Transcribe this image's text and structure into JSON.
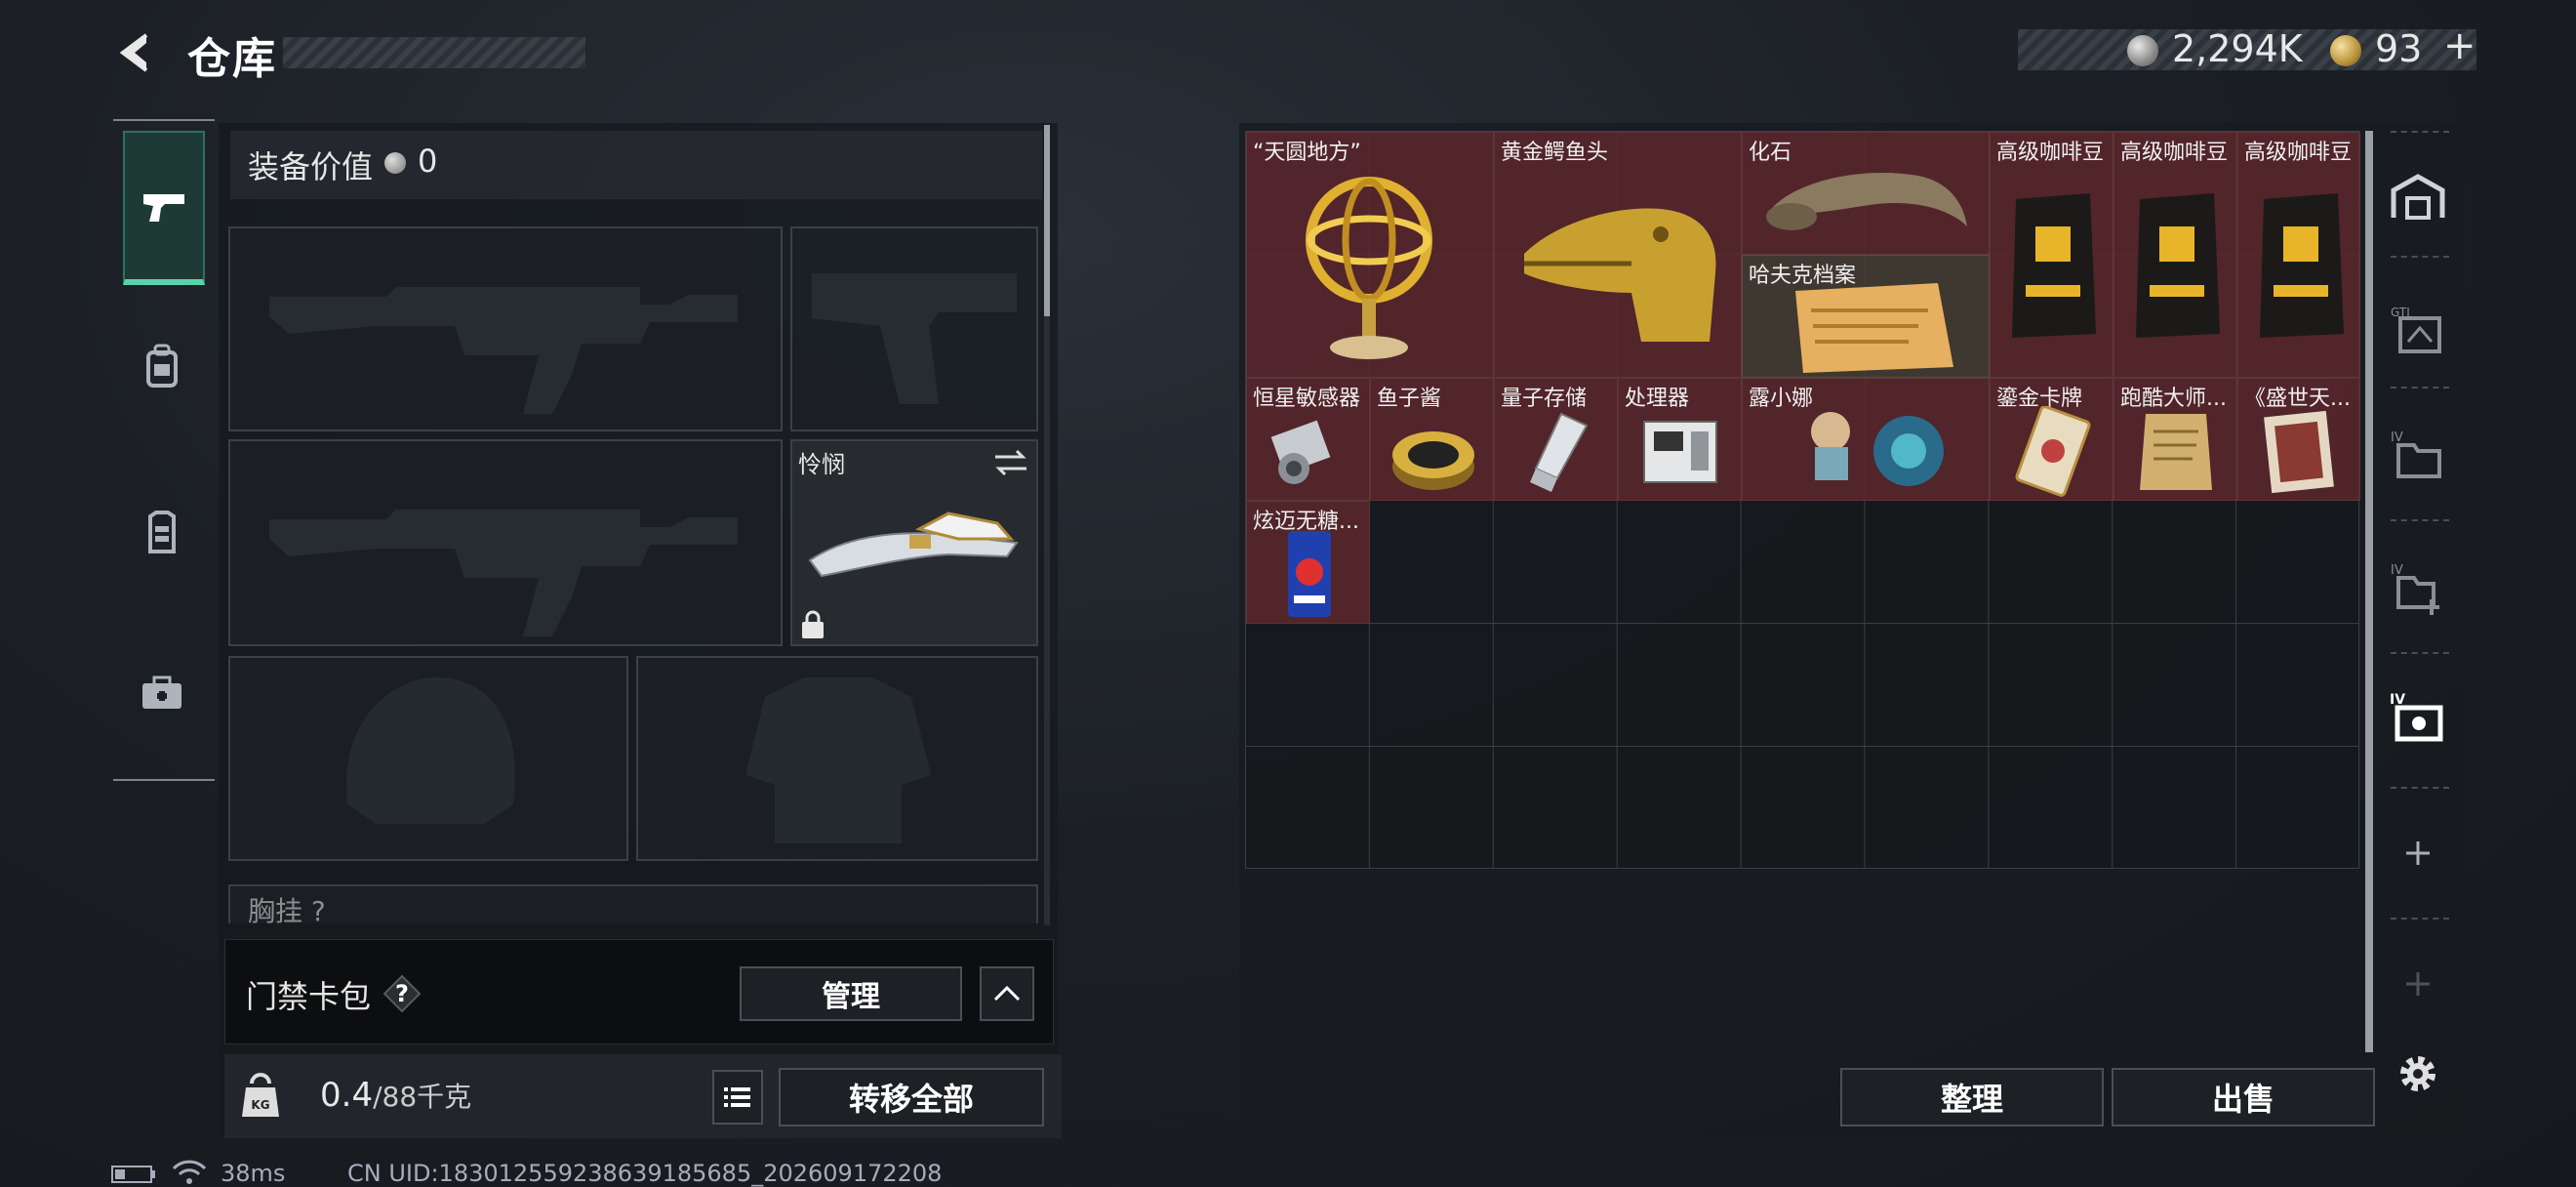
{
  "header": {
    "title": "仓库"
  },
  "currency": {
    "silver": "2,294K",
    "gold": "93",
    "gold_add": "+"
  },
  "equipment": {
    "value_label": "装备价值",
    "value": "0",
    "melee_name": "怜悯",
    "chest_label": "胸挂",
    "chest_help": "?"
  },
  "keycard": {
    "label": "门禁卡包",
    "help": "?",
    "manage_label": "管理"
  },
  "weight": {
    "value": "0.4",
    "unit": "/88千克",
    "kg_label": "KG"
  },
  "buttons": {
    "transfer_all": "转移全部",
    "sort": "整理",
    "sell": "出售"
  },
  "status": {
    "ping": "38ms",
    "uid": "CN UID:1830125592386391856​85_202609172208"
  },
  "warehouse": {
    "items": [
      {
        "name": "“天圆地方”",
        "icon": "armillary-sphere-icon"
      },
      {
        "name": "黄金鳄鱼头",
        "icon": "golden-crocodile-head-icon"
      },
      {
        "name": "化石",
        "icon": "fossil-claw-icon"
      },
      {
        "name": "哈夫克档案",
        "icon": "document-icon"
      },
      {
        "name": "高级咖啡豆",
        "icon": "coffee-bag-icon"
      },
      {
        "name": "高级咖啡豆",
        "icon": "coffee-bag-icon"
      },
      {
        "name": "高级咖啡豆",
        "icon": "coffee-bag-icon"
      },
      {
        "name": "恒星敏感器",
        "icon": "sensor-icon"
      },
      {
        "name": "鱼子酱",
        "icon": "caviar-tin-icon"
      },
      {
        "name": "量子存储",
        "icon": "usb-drive-icon"
      },
      {
        "name": "处理器",
        "icon": "processor-icon"
      },
      {
        "name": "露小娜",
        "icon": "plush-doll-icon"
      },
      {
        "name": "鎏金卡牌",
        "icon": "gold-card-icon"
      },
      {
        "name": "跑酷大师...",
        "icon": "parchment-icon"
      },
      {
        "name": "《盛世天...",
        "icon": "painting-icon"
      },
      {
        "name": "炫迈无糖...",
        "icon": "gum-pack-icon"
      }
    ]
  },
  "colors": {
    "accent": "#56d4a8",
    "item_bg": "#60282e",
    "panel": "#181b1f"
  }
}
